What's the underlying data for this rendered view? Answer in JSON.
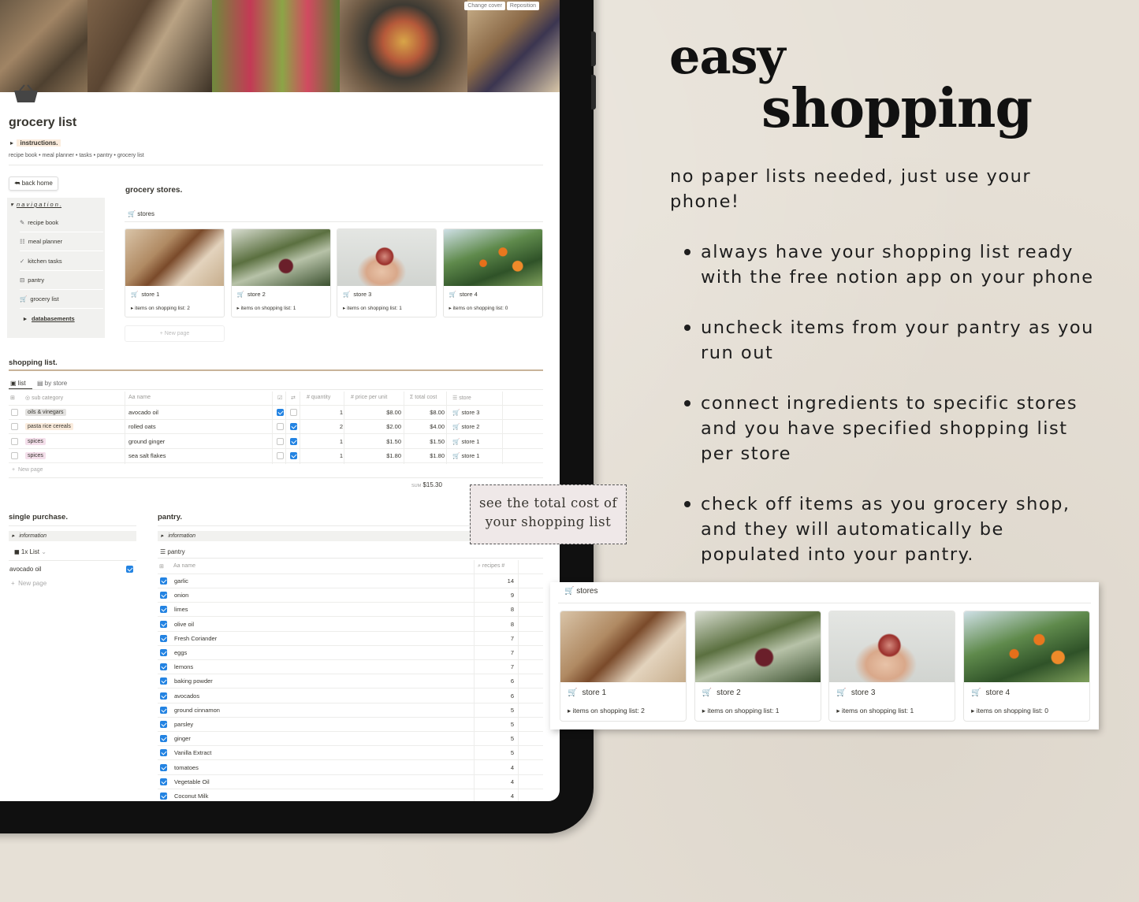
{
  "cover": {
    "change_cover": "Change cover",
    "reposition": "Reposition"
  },
  "page": {
    "title": "grocery list",
    "instructions": "instructions.",
    "breadcrumb": "recipe book • meal planner • tasks • pantry • grocery list"
  },
  "back_home": "back home",
  "navigation": {
    "label": "n a v i g a t i o n .",
    "items": [
      "recipe book",
      "meal planner",
      "kitchen tasks",
      "pantry",
      "grocery list"
    ],
    "databasements": "databasements"
  },
  "stores": {
    "title": "grocery stores.",
    "view": "stores",
    "new_page": "New page",
    "cards": [
      {
        "name": "store 1",
        "prop": "items on shopping list: 2"
      },
      {
        "name": "store 2",
        "prop": "items on shopping list: 1"
      },
      {
        "name": "store 3",
        "prop": "items on shopping list: 1"
      },
      {
        "name": "store 4",
        "prop": "items on shopping list: 0"
      }
    ]
  },
  "shopping": {
    "title": "shopping list.",
    "tabs": [
      "list",
      "by store"
    ],
    "headers": [
      "sub category",
      "name",
      "quantity",
      "price per unit",
      "total cost",
      "store"
    ],
    "rows": [
      {
        "cat": "oils & vinegars",
        "name": "avocado oil",
        "c1": true,
        "c2": false,
        "qty": "1",
        "ppu": "$8.00",
        "total": "$8.00",
        "store": "store 3"
      },
      {
        "cat": "pasta rice cereals",
        "name": "rolled oats",
        "c1": false,
        "c2": true,
        "qty": "2",
        "ppu": "$2.00",
        "total": "$4.00",
        "store": "store 2"
      },
      {
        "cat": "spices",
        "name": "ground ginger",
        "c1": false,
        "c2": true,
        "qty": "1",
        "ppu": "$1.50",
        "total": "$1.50",
        "store": "store 1"
      },
      {
        "cat": "spices",
        "name": "sea salt flakes",
        "c1": false,
        "c2": true,
        "qty": "1",
        "ppu": "$1.80",
        "total": "$1.80",
        "store": "store 1"
      }
    ],
    "new_page": "New page",
    "sum_label": "SUM",
    "sum": "$15.30"
  },
  "tag_colors": {
    "oils & vinegars": "#e3e2e0",
    "pasta rice cereals": "#fbecdd",
    "spices": "#f4dfeb"
  },
  "callout": {
    "line1": "see the total cost of",
    "line2": "your shopping list"
  },
  "single": {
    "title": "single purchase.",
    "info": "information",
    "view": "1x List",
    "item": "avocado oil",
    "new_page": "New page"
  },
  "pantry": {
    "title": "pantry.",
    "info": "information",
    "view": "pantry",
    "h_name": "name",
    "h_num": "recipes #",
    "rows": [
      [
        "garlic",
        "14"
      ],
      [
        "onion",
        "9"
      ],
      [
        "limes",
        "8"
      ],
      [
        "olive oil",
        "8"
      ],
      [
        "Fresh Coriander",
        "7"
      ],
      [
        "eggs",
        "7"
      ],
      [
        "lemons",
        "7"
      ],
      [
        "baking powder",
        "6"
      ],
      [
        "avocados",
        "6"
      ],
      [
        "ground cinnamon",
        "5"
      ],
      [
        "parsley",
        "5"
      ],
      [
        "ginger",
        "5"
      ],
      [
        "Vanilla Extract",
        "5"
      ],
      [
        "tomatoes",
        "4"
      ],
      [
        "Vegetable Oil",
        "4"
      ],
      [
        "Coconut Milk",
        "4"
      ]
    ]
  },
  "headline": {
    "l1": "easy",
    "l2": "shopping"
  },
  "intro": [
    "no paper lists needed, just use your",
    "phone!"
  ],
  "bullets": [
    [
      "always have your shopping list ready",
      "with the free notion app on your phone"
    ],
    [
      "uncheck items from your pantry as you",
      "run out"
    ],
    [
      "connect ingredients to specific stores",
      "and you have specified shopping list",
      "per store"
    ],
    [
      "check off items as you grocery shop,",
      "and they will automatically be",
      "populated into your pantry."
    ]
  ],
  "zoom": {
    "view": "stores"
  }
}
